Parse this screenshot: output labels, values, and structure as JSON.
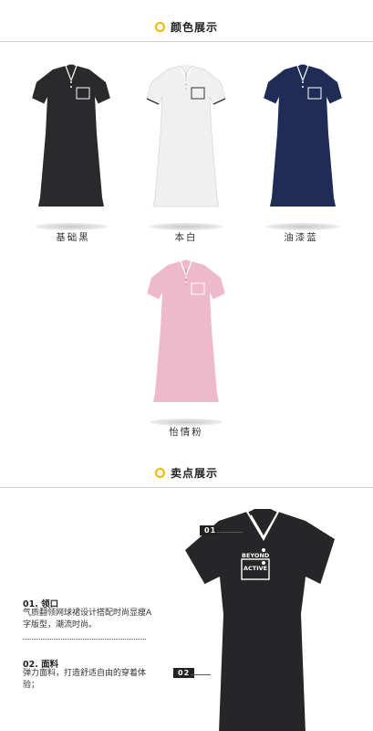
{
  "colors_section": {
    "title": "颜色展示",
    "items": [
      {
        "label": "基础黑",
        "color": "#2a2a2c"
      },
      {
        "label": "本白",
        "color": "#f4f4f4"
      },
      {
        "label": "油漆蓝",
        "color": "#1f2c55"
      },
      {
        "label": "怡情粉",
        "color": "#efb9cc"
      }
    ]
  },
  "features_section": {
    "title": "卖点展示",
    "features": [
      {
        "title": "01.  领口",
        "text": "气质翻领网球裙设计搭配时尚显瘦A字版型，潮流时尚。",
        "tag": "01"
      },
      {
        "title": "02.  面料",
        "text": "弹力面料，打造舒适自由的穿着体验；",
        "tag": "02"
      }
    ],
    "chest_print": [
      "BEYOND",
      "ACTIVE"
    ]
  },
  "accent_color": "#f2b705"
}
